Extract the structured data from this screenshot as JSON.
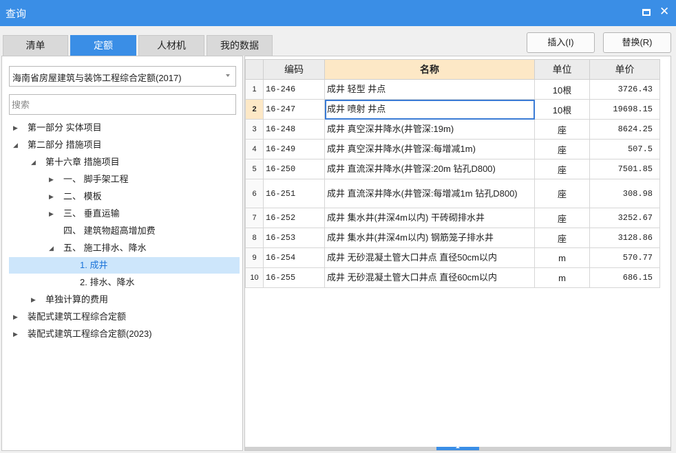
{
  "window": {
    "title": "查询"
  },
  "tabs": [
    {
      "label": "清单",
      "active": false
    },
    {
      "label": "定额",
      "active": true
    },
    {
      "label": "人材机",
      "active": false
    },
    {
      "label": "我的数据",
      "active": false
    }
  ],
  "actions": {
    "insert_label": "插入(I)",
    "replace_label": "替换(R)"
  },
  "library_select": {
    "value": "海南省房屋建筑与装饰工程综合定额(2017)"
  },
  "search": {
    "placeholder": "搜索",
    "value": ""
  },
  "tree": [
    {
      "label": "第一部分 实体项目",
      "toggle": "▶"
    },
    {
      "label": "第二部分 措施项目",
      "toggle": "◢"
    },
    {
      "label": "第十六章 措施项目",
      "toggle": "◢"
    },
    {
      "label": "一、 脚手架工程",
      "toggle": "▶"
    },
    {
      "label": "二、 模板",
      "toggle": "▶"
    },
    {
      "label": "三、 垂直运输",
      "toggle": "▶"
    },
    {
      "label": "四、 建筑物超高增加费",
      "toggle": ""
    },
    {
      "label": "五、 施工排水、降水",
      "toggle": "◢"
    },
    {
      "label": "1. 成井",
      "toggle": "",
      "selected": true
    },
    {
      "label": "2. 排水、降水",
      "toggle": ""
    },
    {
      "label": "单独计算的费用",
      "toggle": "▶"
    },
    {
      "label": "装配式建筑工程综合定额",
      "toggle": "▶"
    },
    {
      "label": "装配式建筑工程综合定额(2023)",
      "toggle": "▶"
    }
  ],
  "grid": {
    "columns": [
      "编码",
      "名称",
      "单位",
      "单价"
    ],
    "rows": [
      {
        "idx": "1",
        "code": "16-246",
        "name": "成井 轻型 井点",
        "unit": "10根",
        "price": "3726.43"
      },
      {
        "idx": "2",
        "code": "16-247",
        "name": "成井 喷射 井点",
        "unit": "10根",
        "price": "19698.15",
        "selected": true
      },
      {
        "idx": "3",
        "code": "16-248",
        "name": "成井 真空深井降水(井管深:19m)",
        "unit": "座",
        "price": "8624.25"
      },
      {
        "idx": "4",
        "code": "16-249",
        "name": "成井 真空深井降水(井管深:每增减1m)",
        "unit": "座",
        "price": "507.5"
      },
      {
        "idx": "5",
        "code": "16-250",
        "name": "成井 直流深井降水(井管深:20m 钻孔D800)",
        "unit": "座",
        "price": "7501.85"
      },
      {
        "idx": "6",
        "code": "16-251",
        "name": "成井 直流深井降水(井管深:每增减1m 钻孔D800)",
        "unit": "座",
        "price": "308.98"
      },
      {
        "idx": "7",
        "code": "16-252",
        "name": "成井 集水井(井深4m以内) 干砖砌排水井",
        "unit": "座",
        "price": "3252.67"
      },
      {
        "idx": "8",
        "code": "16-253",
        "name": "成井 集水井(井深4m以内) 钢筋笼子排水井",
        "unit": "座",
        "price": "3128.86"
      },
      {
        "idx": "9",
        "code": "16-254",
        "name": "成井 无砂混凝土管大口井点 直径50cm以内",
        "unit": "m",
        "price": "570.77"
      },
      {
        "idx": "10",
        "code": "16-255",
        "name": "成井 无砂混凝土管大口井点 直径60cm以内",
        "unit": "m",
        "price": "686.15"
      }
    ]
  },
  "colors": {
    "accent": "#3a8ee6",
    "header_highlight": "#fde8c6",
    "tree_selected": "#cde6fb"
  },
  "icons": {
    "maximize": "maximize-icon",
    "close": "close-icon"
  }
}
